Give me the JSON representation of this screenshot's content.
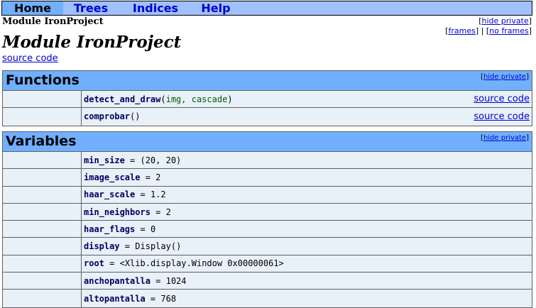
{
  "nav": {
    "home": "Home",
    "trees": "Trees",
    "indices": "Indices",
    "help": "Help"
  },
  "breadcrumb": "Module IronProject",
  "toplinks": {
    "hide_private": "hide private",
    "frames": "frames",
    "no_frames": "no frames",
    "sep": "|"
  },
  "title": "Module IronProject",
  "source_code": "source code",
  "functions": {
    "title": "Functions",
    "hide_private": "hide private",
    "items": [
      {
        "name": "detect_and_draw",
        "open": "(",
        "params": "img, cascade",
        "close": ")",
        "link": "source code"
      },
      {
        "name": "comprobar",
        "open": "(",
        "params": "",
        "close": ")",
        "link": "source code"
      }
    ]
  },
  "variables": {
    "title": "Variables",
    "hide_private": "hide private",
    "items": [
      {
        "name": "min_size",
        "eq": " = ",
        "value": "(20, 20)"
      },
      {
        "name": "image_scale",
        "eq": " = ",
        "value": "2"
      },
      {
        "name": "haar_scale",
        "eq": " = ",
        "value": "1.2"
      },
      {
        "name": "min_neighbors",
        "eq": " = ",
        "value": "2"
      },
      {
        "name": "haar_flags",
        "eq": " = ",
        "value": "0"
      },
      {
        "name": "display",
        "eq": " = ",
        "value": "Display()"
      },
      {
        "name": "root",
        "eq": " = ",
        "value": "<Xlib.display.Window 0x00000061>"
      },
      {
        "name": "anchopantalla",
        "eq": " = ",
        "value": "1024"
      },
      {
        "name": "altopantalla",
        "eq": " = ",
        "value": "768"
      }
    ]
  }
}
